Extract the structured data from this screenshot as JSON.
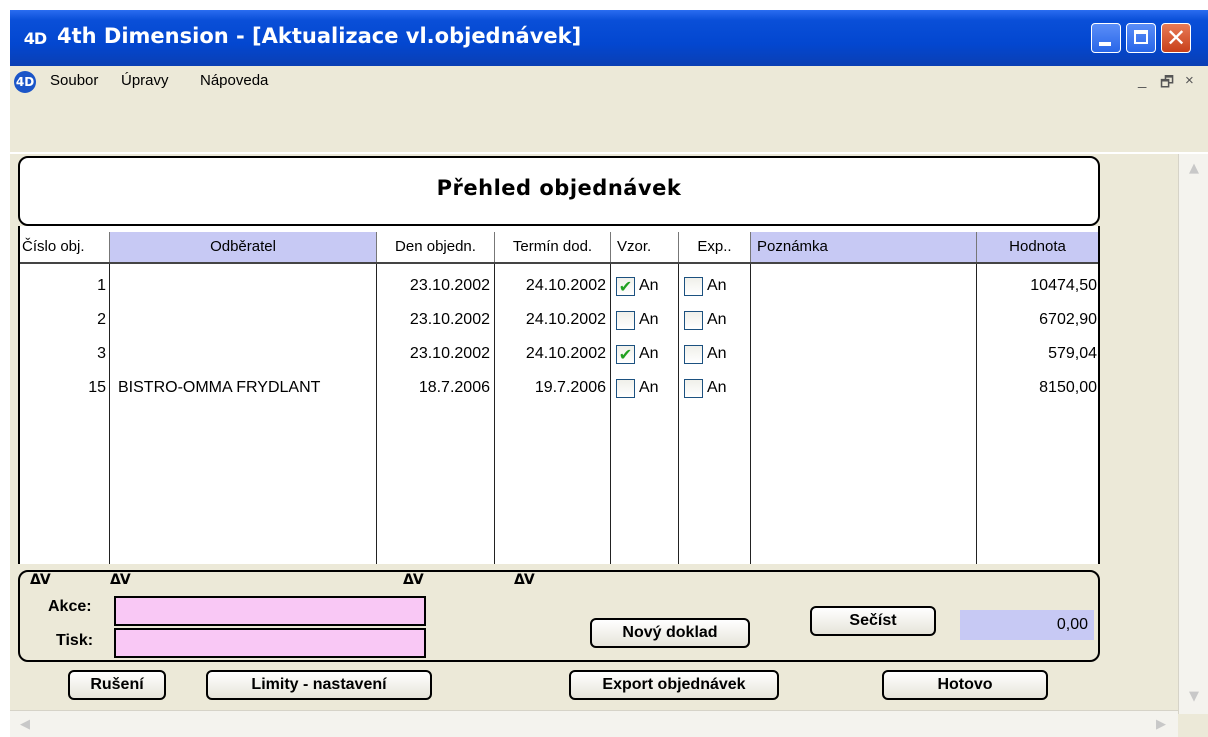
{
  "window": {
    "title": "4th Dimension - [Aktualizace vl.objednávek]",
    "app_icon": "4D"
  },
  "menu": {
    "logo": "4D",
    "items": [
      "Soubor",
      "Úpravy",
      "Nápoveda"
    ],
    "mdi_controls": [
      "_",
      "🗗",
      "×"
    ]
  },
  "form": {
    "title": "Přehled objednávek",
    "columns": [
      "Číslo obj.",
      "Odběratel",
      "Den objedn.",
      "Termín dod.",
      "Vzor.",
      "Exp..",
      "Poznámka",
      "Hodnota"
    ],
    "rows": [
      {
        "cislo": "1",
        "odberatel": "",
        "den": "23.10.2002",
        "termin": "24.10.2002",
        "vzor_checked": true,
        "vzor_label": "An",
        "exp_checked": false,
        "exp_label": "An",
        "poznamka": "",
        "hodnota": "10474,50"
      },
      {
        "cislo": "2",
        "odberatel": "",
        "den": "23.10.2002",
        "termin": "24.10.2002",
        "vzor_checked": false,
        "vzor_label": "An",
        "exp_checked": false,
        "exp_label": "An",
        "poznamka": "",
        "hodnota": "6702,90"
      },
      {
        "cislo": "3",
        "odberatel": "",
        "den": "23.10.2002",
        "termin": "24.10.2002",
        "vzor_checked": true,
        "vzor_label": "An",
        "exp_checked": false,
        "exp_label": "An",
        "poznamka": "",
        "hodnota": "579,04"
      },
      {
        "cislo": "15",
        "odberatel": "BISTRO-OMMA FRYDLANT",
        "den": "18.7.2006",
        "termin": "19.7.2006",
        "vzor_checked": false,
        "vzor_label": "An",
        "exp_checked": false,
        "exp_label": "An",
        "poznamka": "",
        "hodnota": "8150,00"
      }
    ],
    "sort_glyph": "ΔV",
    "akce_label": "Akce:",
    "akce_value": "",
    "tisk_label": "Tisk:",
    "tisk_value": "",
    "new_doc_button": "Nový doklad",
    "sum_button": "Sečíst",
    "sum_value": "0,00"
  },
  "buttons": {
    "cancel": "Rušení",
    "limits": "Limity - nastavení",
    "export": "Export objednávek",
    "done": "Hotovo"
  },
  "icons": {
    "check": "✔",
    "close": "✕",
    "scroll_up": "▲",
    "scroll_down": "▼",
    "scroll_left": "◀",
    "scroll_right": "▶"
  },
  "colors": {
    "titlebar": "#0347d0",
    "header_blue": "#c7c9f4",
    "pink_field": "#f9c8f5",
    "window_bg": "#ece9d8"
  }
}
